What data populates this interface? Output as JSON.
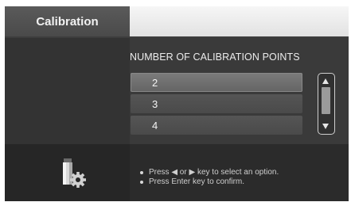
{
  "header": {
    "title": "Calibration"
  },
  "main": {
    "heading": "NUMBER OF CALIBRATION POINTS",
    "options": [
      "2",
      "3",
      "4"
    ],
    "selected_index": 0
  },
  "footer": {
    "hints": [
      "Press ◀ or ▶ key to select an option.",
      "Press Enter key to confirm."
    ],
    "icon": "calibration-device-gear-icon"
  },
  "colors": {
    "background": "#3d3d3d",
    "selected_option": "#707070",
    "option": "#505050",
    "text": "#f2f2f2"
  }
}
